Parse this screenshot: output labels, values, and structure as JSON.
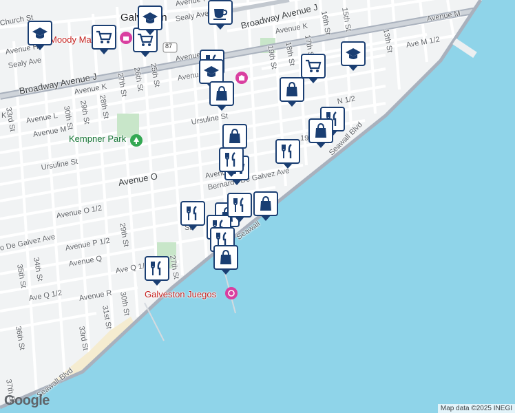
{
  "map": {
    "colors": {
      "water": "#8fd4e9",
      "land": "#f1f3f4",
      "road": "#ffffff",
      "highway": "#a9b1bd",
      "park": "#c8e6c9",
      "marker": "#1a3e72",
      "poi": "#c5221f"
    }
  },
  "labels": {
    "city": "Galveston",
    "broadway_east": "Broadway Avenue J",
    "broadway_west": "Broadway Avenue J",
    "seawall_east": "Seawall Blvd",
    "seawall_mid": "Seawall",
    "seawall_west": "Seawall Blvd",
    "bernardo": "Bernardo De Galvez Ave",
    "de_galvez_west": "o De Galvez Ave",
    "avenue_o": "Avenue O",
    "avenue_o_half": "Avenue O 1/2",
    "avenue_p_half": "Avenue P 1/2",
    "avenue_q": "Avenue Q",
    "ave_q_half": "Ave Q 1/",
    "ave_q_half_west": "Ave Q 1/2",
    "avenue_r": "Avenue R",
    "avenue_k_west": "Avenue K",
    "avenue_k_east": "Avenue K",
    "avenue_l": "Avenue L",
    "avenue_m_west": "Avenue M",
    "avenue_m_east": "Avenue M",
    "ave_m_half": "Ave M 1/2",
    "avenue_n_half": "N 1/2",
    "avenue_top": "Avenue I",
    "avenue_top2": "Avenue",
    "avenue_mid": "Avenue",
    "avenue_n_short": "Avenue",
    "avenue_ber": "Avenue",
    "ursuline_mid": "Ursuline St",
    "ursuline_west": "Ursuline St",
    "sealy_ave_west": "Sealy Ave",
    "sealy_ave_east": "Sealy Ave",
    "church_st": "Church St",
    "avenue_h": "Avenue H",
    "avenue_i": "Avenue I",
    "moody": "Moody Ma",
    "st_33": "33rd St",
    "st_33b": "33rd St",
    "st_30": "30th St",
    "st_30b": "30th St",
    "st_29": "29th St",
    "st_29b": "29th St",
    "st_28": "28th St",
    "st_27": "27th St",
    "st_27b": "27th St",
    "st_26": "26th St",
    "st_25": "25th St",
    "st_19": "19th St",
    "st_19b": "19th St",
    "st_18": "18th St",
    "st_17": "17th St",
    "st_16": "16th St",
    "st_15": "15th St",
    "st_13": "13th St",
    "st_31": "31st St",
    "st_34": "34th St",
    "st_35": "35th St",
    "st_36": "36th St",
    "st_37": "37th St",
    "st_k": "K",
    "st_r": "R",
    "st_frag": "St",
    "route_87": "87",
    "kempner_park": "Kempner Park",
    "galveston_juegos": "Galveston Juegos"
  },
  "markers": [
    {
      "type": "school-icon"
    },
    {
      "type": "grocery-icon"
    },
    {
      "type": "grocery-icon"
    },
    {
      "type": "school-icon"
    },
    {
      "type": "cafe-icon"
    },
    {
      "type": "restaurant-icon"
    },
    {
      "type": "school-icon"
    },
    {
      "type": "shopping-icon"
    },
    {
      "type": "shopping-icon"
    },
    {
      "type": "grocery-icon"
    },
    {
      "type": "school-icon"
    },
    {
      "type": "restaurant-icon"
    },
    {
      "type": "shopping-icon"
    },
    {
      "type": "shopping-icon"
    },
    {
      "type": "restaurant-icon"
    },
    {
      "type": "grocery-icon"
    },
    {
      "type": "restaurant-icon"
    },
    {
      "type": "shopping-icon"
    },
    {
      "type": "restaurant-icon"
    },
    {
      "type": "shopping-icon"
    },
    {
      "type": "restaurant-icon"
    },
    {
      "type": "restaurant-icon"
    },
    {
      "type": "restaurant-icon"
    },
    {
      "type": "shopping-icon"
    },
    {
      "type": "restaurant-icon"
    }
  ],
  "attribution": {
    "logo": "Google",
    "text": "Map data ©2025 INEGI"
  }
}
